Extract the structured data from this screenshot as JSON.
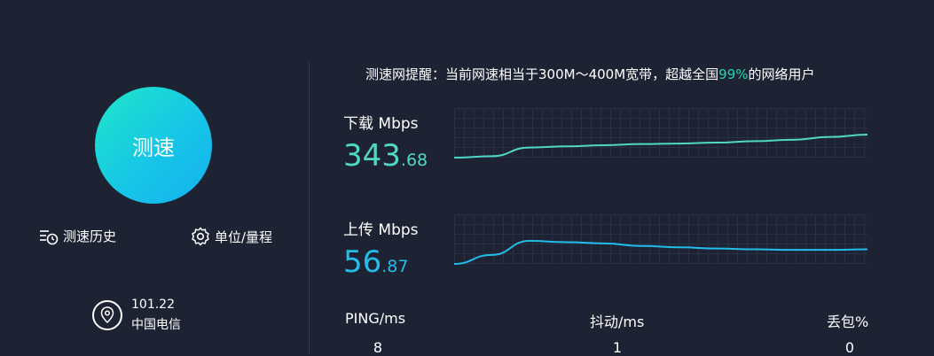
{
  "start_button": {
    "label": "测速"
  },
  "tools": {
    "history_label": "测速历史",
    "units_label": "单位/量程"
  },
  "server": {
    "ip": "101.22",
    "isp": "中国电信"
  },
  "notice": {
    "prefix": "测速网提醒：当前网速相当于300M～400M宽带，超越全国",
    "percent": "99%",
    "suffix": "的网络用户"
  },
  "download": {
    "label": "下载 Mbps",
    "int": "343",
    "dec": ".68",
    "color": "#4fd8c3",
    "trend": [
      2,
      8,
      45,
      50,
      55,
      60,
      62,
      66,
      72,
      78,
      90,
      100
    ]
  },
  "upload": {
    "label": "上传 Mbps",
    "int": "56",
    "dec": ".87",
    "color": "#22bde8",
    "trend": [
      5,
      40,
      95,
      90,
      85,
      75,
      70,
      65,
      62,
      60,
      60,
      62
    ]
  },
  "stats": {
    "ping": {
      "label": "PING/ms",
      "value": "8"
    },
    "jitter": {
      "label": "抖动/ms",
      "value": "1"
    },
    "loss": {
      "label": "丢包%",
      "value": "0"
    }
  }
}
